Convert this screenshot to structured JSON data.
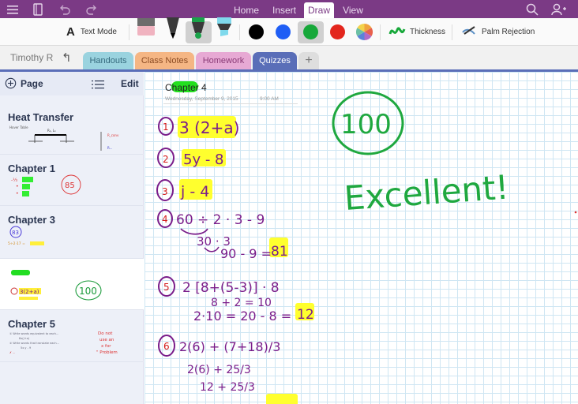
{
  "topbar": {
    "icons": [
      "hamburger-menu-icon",
      "notebooks-icon",
      "undo-icon",
      "redo-icon",
      "search-icon",
      "add-person-icon"
    ],
    "tabs": [
      {
        "label": "Home",
        "active": false
      },
      {
        "label": "Insert",
        "active": false
      },
      {
        "label": "Draw",
        "active": true
      },
      {
        "label": "View",
        "active": false
      }
    ]
  },
  "ribbon": {
    "text_mode_label": "Text Mode",
    "tools": [
      "eraser",
      "pen-black",
      "pen-green",
      "highlighter-blue"
    ],
    "selected_tool": "pen-green",
    "colors": [
      {
        "name": "black",
        "hex": "#000000"
      },
      {
        "name": "blue",
        "hex": "#1f5ef5"
      },
      {
        "name": "green",
        "hex": "#17a83a"
      },
      {
        "name": "red",
        "hex": "#e3261d"
      }
    ],
    "selected_color": "green",
    "thickness_label": "Thickness",
    "palm_rejection_label": "Palm Rejection"
  },
  "sections": {
    "owner": "Timothy R",
    "tabs": [
      {
        "label": "Handouts",
        "color": "#9ad3df"
      },
      {
        "label": "Class Notes",
        "color": "#f5b684"
      },
      {
        "label": "Homework",
        "color": "#e7a9d4"
      },
      {
        "label": "Quizzes",
        "color": "#5a6eb8",
        "active": true
      }
    ],
    "add_label": "+"
  },
  "sidebar": {
    "add_page_label": "Page",
    "edit_label": "Edit",
    "pages": [
      {
        "title": "Heat Transfer"
      },
      {
        "title": "Chapter 1",
        "score": "85"
      },
      {
        "title": "Chapter 3",
        "score": "83"
      },
      {
        "title": "",
        "score": "100",
        "selected": true
      },
      {
        "title": "Chapter 5",
        "note": "Do not use an x for Problem"
      }
    ]
  },
  "note": {
    "title": "Chapter 4",
    "date": "Wednesday, September 9, 2015",
    "time": "9:00 AM",
    "score": "100",
    "comment": "Excellent!",
    "problems": [
      {
        "num": "1",
        "work": [
          "3 (2+a)"
        ]
      },
      {
        "num": "2",
        "work": [
          "5y - 8"
        ]
      },
      {
        "num": "3",
        "work": [
          "j - 4"
        ]
      },
      {
        "num": "4",
        "work": [
          "60 ÷ 2 · 3 - 9",
          "30 · 3",
          "90 - 9 =",
          "81"
        ]
      },
      {
        "num": "5",
        "work": [
          "2 [8+(5-3)] · 8",
          "8 + 2 = 10",
          "2·10 = 20 - 8 =",
          "12"
        ]
      },
      {
        "num": "6",
        "work": [
          "2(6) + (7+18)/3",
          "2(6) + 25/3",
          "12 + 25/3"
        ]
      }
    ]
  }
}
